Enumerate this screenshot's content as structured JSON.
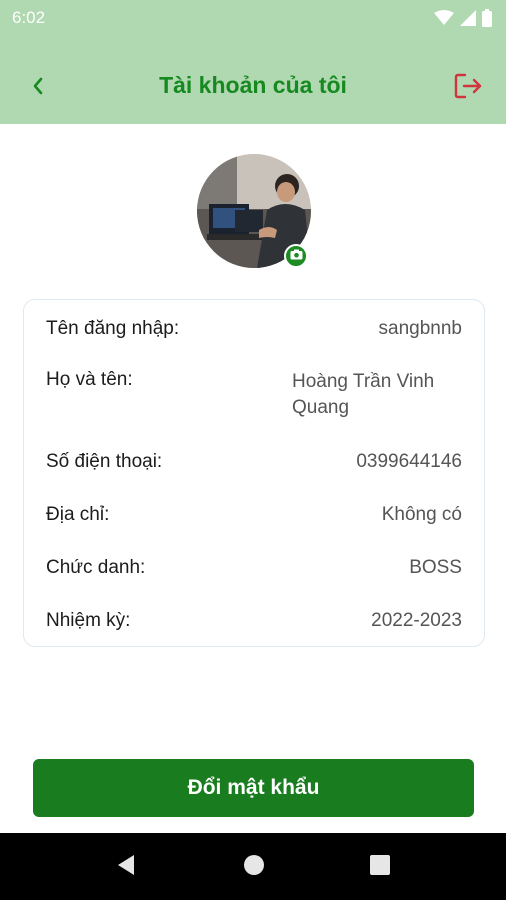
{
  "status_bar": {
    "time": "6:02",
    "icons": [
      "wifi-icon",
      "signal-icon",
      "battery-icon"
    ]
  },
  "app_bar": {
    "title": "Tài khoản của tôi",
    "back_icon": "chevron-left-icon",
    "logout_icon": "logout-icon"
  },
  "profile": {
    "avatar": "profile-photo",
    "camera_icon": "camera-icon"
  },
  "account_info": [
    {
      "label": "Tên đăng nhập:",
      "value": "sangbnnb"
    },
    {
      "label": "Họ và tên:",
      "value": "Hoàng Trần Vinh Quang"
    },
    {
      "label": "Số điện thoại:",
      "value": "0399644146"
    },
    {
      "label": "Địa chỉ:",
      "value": "Không có"
    },
    {
      "label": "Chức danh:",
      "value": "BOSS"
    },
    {
      "label": "Nhiệm kỳ:",
      "value": "2022-2023"
    }
  ],
  "change_password_button": {
    "label": "Đổi mật khẩu"
  },
  "colors": {
    "header_bg": "#b0d8b1",
    "title": "#168a21",
    "primary_button": "#197d20",
    "logout_icon": "#d0343c",
    "nav_bar": "#000000"
  },
  "nav_bar": {
    "buttons": [
      "back-triangle-icon",
      "home-circle-icon",
      "recents-square-icon"
    ]
  }
}
